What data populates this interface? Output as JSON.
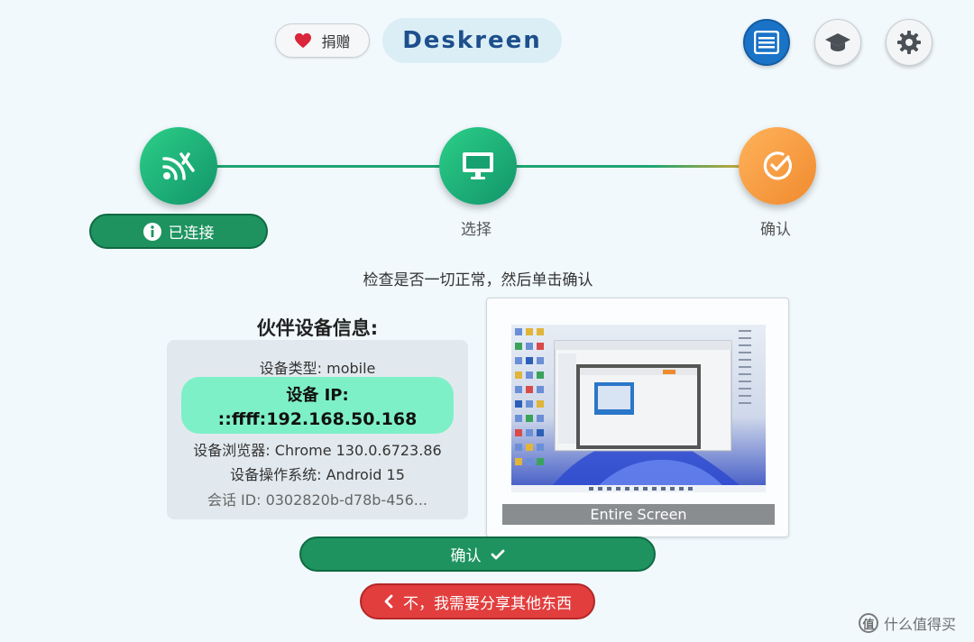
{
  "header": {
    "donate_label": "捐赠",
    "logo_text": "Deskreen",
    "colors": {
      "primary": "#1a73c7"
    }
  },
  "stepper": {
    "steps": [
      {
        "label": "已连接",
        "icon": "wifi-signal-icon",
        "state": "done"
      },
      {
        "label": "选择",
        "icon": "monitor-icon",
        "state": "done"
      },
      {
        "label": "确认",
        "icon": "check-circle-icon",
        "state": "active"
      }
    ],
    "colors": {
      "done": "#1e9360",
      "active": "#f39a3a"
    }
  },
  "hint": "检查是否一切正常，然后单击确认",
  "partner": {
    "title": "伙伴设备信息:",
    "device_type": "设备类型: mobile",
    "ip_label": "设备 IP:",
    "ip_value": "::ffff:192.168.50.168",
    "browser": "设备浏览器: Chrome 130.0.6723.86",
    "os": "设备操作系统: Android 15",
    "session": "会话 ID: 0302820b-d78b-456..."
  },
  "preview": {
    "caption": "Entire Screen"
  },
  "actions": {
    "confirm_label": "确认",
    "cancel_label": "不，我需要分享其他东西"
  },
  "watermark": {
    "logo": "值",
    "text": "什么值得买"
  }
}
